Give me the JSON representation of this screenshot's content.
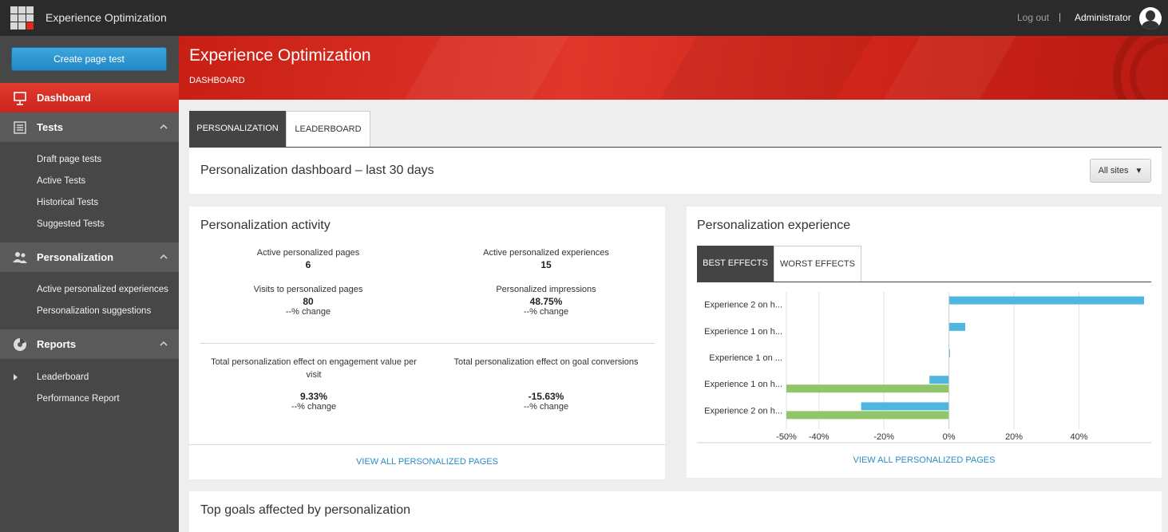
{
  "topbar": {
    "app_name": "Experience Optimization",
    "logout": "Log out",
    "separator": "|",
    "user": "Administrator"
  },
  "sidebar": {
    "create_button": "Create page test",
    "dashboard": "Dashboard",
    "sections": [
      {
        "label": "Tests",
        "icon": "list-icon",
        "items": [
          "Draft page tests",
          "Active Tests",
          "Historical Tests",
          "Suggested Tests"
        ]
      },
      {
        "label": "Personalization",
        "icon": "users-icon",
        "items": [
          "Active personalized experiences",
          "Personalization suggestions"
        ]
      },
      {
        "label": "Reports",
        "icon": "chart-icon",
        "items": [
          "Leaderboard",
          "Performance Report"
        ]
      }
    ]
  },
  "header": {
    "title": "Experience Optimization",
    "breadcrumb": "DASHBOARD"
  },
  "tabs": [
    "PERSONALIZATION",
    "LEADERBOARD"
  ],
  "dashboard": {
    "title": "Personalization dashboard – last 30 days",
    "site_filter": "All sites"
  },
  "activity": {
    "title": "Personalization activity",
    "metrics": [
      {
        "label": "Active personalized pages",
        "value": "6",
        "change": ""
      },
      {
        "label": "Active personalized experiences",
        "value": "15",
        "change": ""
      },
      {
        "label": "Visits to personalized pages",
        "value": "80",
        "change": "--% change"
      },
      {
        "label": "Personalized impressions",
        "value": "48.75%",
        "change": "--% change"
      },
      {
        "label": "Total personalization effect on engagement value per visit",
        "value": "9.33%",
        "change": "--% change"
      },
      {
        "label": "Total personalization effect on goal conversions",
        "value": "-15.63%",
        "change": "--% change"
      }
    ],
    "link": "VIEW ALL PERSONALIZED PAGES"
  },
  "experience": {
    "title": "Personalization experience",
    "subtabs": [
      "BEST EFFECTS",
      "WORST EFFECTS"
    ],
    "link": "VIEW ALL PERSONALIZED PAGES"
  },
  "goals": {
    "title": "Top goals affected by personalization"
  },
  "colors": {
    "accent_red": "#d62d22",
    "bar_blue": "#4fb6e0",
    "bar_green": "#91c569",
    "link_blue": "#2a8dc4"
  },
  "chart_data": {
    "type": "bar",
    "orientation": "horizontal",
    "categories": [
      "Experience 2 on h...",
      "Experience 1 on h...",
      "Experience 1 on ...",
      "Experience 1 on h...",
      "Experience 2 on h..."
    ],
    "series": [
      {
        "values": [
          60,
          5,
          0.3,
          -6,
          -27
        ]
      },
      {
        "values": [
          0,
          0,
          0,
          -50,
          -50
        ]
      }
    ],
    "ticks": [
      {
        "value": -50,
        "label": "-50%"
      },
      {
        "value": -40,
        "label": "-40%"
      },
      {
        "value": -20,
        "label": "-20%"
      },
      {
        "value": 0,
        "label": "0%"
      },
      {
        "value": 20,
        "label": "20%"
      },
      {
        "value": 40,
        "label": "40%"
      }
    ],
    "xlim": [
      -50,
      60
    ],
    "grid": true
  }
}
